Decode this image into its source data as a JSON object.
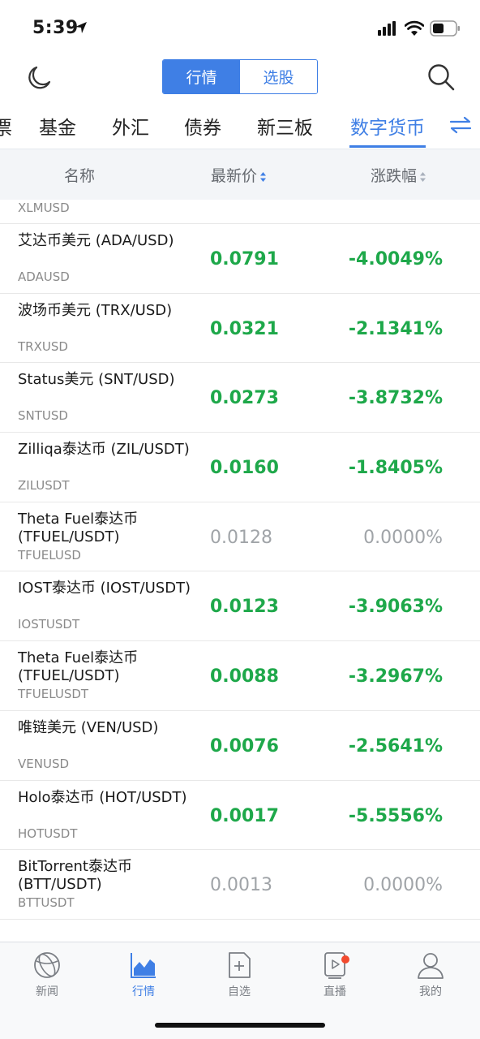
{
  "status_bar": {
    "time": "5:39"
  },
  "header": {
    "segments": [
      "行情",
      "选股"
    ],
    "active_segment": 0
  },
  "tabs": [
    "票",
    "基金",
    "外汇",
    "债券",
    "新三板",
    "数字货币"
  ],
  "active_tab": 5,
  "columns": {
    "name": "名称",
    "price": "最新价",
    "change": "涨跌幅"
  },
  "partial_row": {
    "symbol": "XLMUSD"
  },
  "rows": [
    {
      "name": "艾达币美元 (ADA/USD)",
      "symbol": "ADAUSD",
      "price": "0.0791",
      "change": "-4.0049%",
      "status": "down"
    },
    {
      "name": "波场币美元 (TRX/USD)",
      "symbol": "TRXUSD",
      "price": "0.0321",
      "change": "-2.1341%",
      "status": "down"
    },
    {
      "name": "Status美元 (SNT/USD)",
      "symbol": "SNTUSD",
      "price": "0.0273",
      "change": "-3.8732%",
      "status": "down"
    },
    {
      "name": "Zilliqa泰达币 (ZIL/USDT)",
      "symbol": "ZILUSDT",
      "price": "0.0160",
      "change": "-1.8405%",
      "status": "down"
    },
    {
      "name": "Theta Fuel泰达币 (TFUEL/USDT)",
      "symbol": "TFUELUSD",
      "price": "0.0128",
      "change": "0.0000%",
      "status": "flat"
    },
    {
      "name": "IOST泰达币 (IOST/USDT)",
      "symbol": "IOSTUSDT",
      "price": "0.0123",
      "change": "-3.9063%",
      "status": "down"
    },
    {
      "name": "Theta Fuel泰达币 (TFUEL/USDT)",
      "symbol": "TFUELUSDT",
      "price": "0.0088",
      "change": "-3.2967%",
      "status": "down"
    },
    {
      "name": "唯链美元 (VEN/USD)",
      "symbol": "VENUSD",
      "price": "0.0076",
      "change": "-2.5641%",
      "status": "down"
    },
    {
      "name": "Holo泰达币 (HOT/USDT)",
      "symbol": "HOTUSDT",
      "price": "0.0017",
      "change": "-5.5556%",
      "status": "down"
    },
    {
      "name": "BitTorrent泰达币 (BTT/USDT)",
      "symbol": "BTTUSDT",
      "price": "0.0013",
      "change": "0.0000%",
      "status": "flat"
    }
  ],
  "bottom_nav": [
    {
      "label": "新闻",
      "icon": "globe-icon"
    },
    {
      "label": "行情",
      "icon": "chart-icon"
    },
    {
      "label": "自选",
      "icon": "folder-add-icon"
    },
    {
      "label": "直播",
      "icon": "live-play-icon"
    },
    {
      "label": "我的",
      "icon": "person-icon"
    }
  ],
  "active_nav": 1,
  "colors": {
    "accent": "#3f7fe5",
    "down": "#1ea84a",
    "flat": "#a0a4a8",
    "badge": "#f24a2e"
  }
}
